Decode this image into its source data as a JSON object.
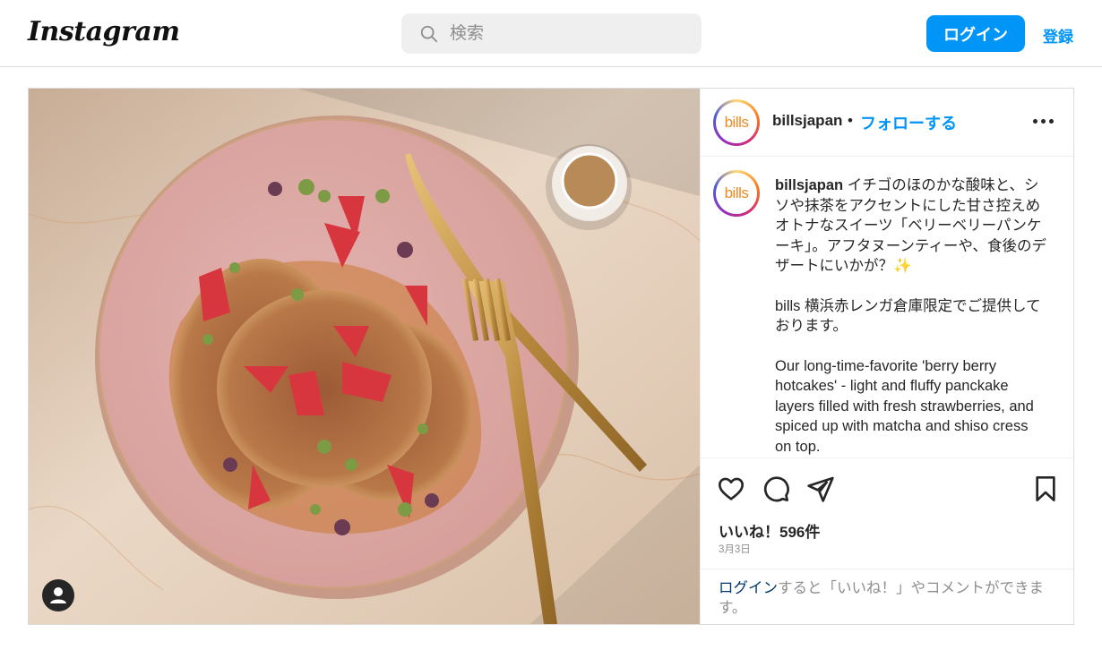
{
  "header": {
    "logo": "Instagram",
    "search_placeholder": "検索",
    "login_label": "ログイン",
    "signup_label": "登録"
  },
  "post": {
    "username": "billsjapan",
    "avatar_text": "bills",
    "dot": "•",
    "follow_label": "フォローする",
    "caption_username": "billsjapan",
    "caption_p1": "イチゴのほのかな酸味と、シソや抹茶をアクセントにした甘さ控えめオトナなスイーツ「ベリーベリーパンケーキ」。アフタヌーンティーや、食後のデザートにいかが？✨",
    "caption_p2": "bills 横浜赤レンガ倉庫限定でご提供しております。",
    "caption_p3": "Our long-time-favorite 'berry berry hotcakes' - light and fluffy panckake layers filled with fresh strawberries, and spiced up with matcha and shiso cress on top.",
    "likes": "いいね！596件",
    "date": "3月3日",
    "login_prompt_link": "ログイン",
    "login_prompt_rest": "すると「いいね！」やコメントができます。"
  },
  "colors": {
    "accent": "#0095f6",
    "text": "#262626",
    "muted": "#8e8e8e",
    "border": "#dbdbdb"
  },
  "icons": [
    "search-icon",
    "more-options-icon",
    "heart-icon",
    "comment-icon",
    "share-icon",
    "bookmark-icon",
    "user-icon"
  ]
}
